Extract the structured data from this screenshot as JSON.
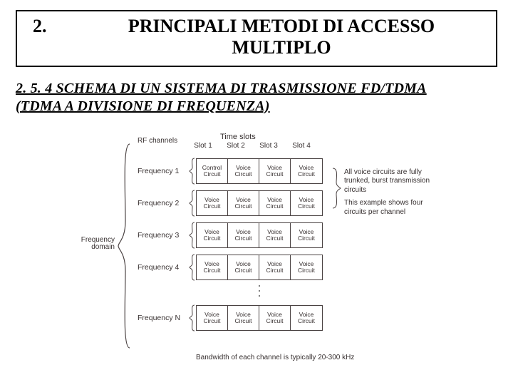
{
  "header": {
    "number": "2.",
    "title_line1": "PRINCIPALI METODI DI ACCESSO",
    "title_line2": "MULTIPLO"
  },
  "subtitle": {
    "line1": "2. 5. 4  SCHEMA DI UN SISTEMA DI TRASMISSIONE FD/TDMA",
    "line2": "(TDMA A DIVISIONE DI FREQUENZA)"
  },
  "diagram": {
    "time_label": "Time slots",
    "slot_headers": [
      "Slot 1",
      "Slot 2",
      "Slot 3",
      "Slot 4"
    ],
    "rf_label": "RF channels",
    "freq_domain_l1": "Frequency",
    "freq_domain_l2": "domain",
    "rows": [
      {
        "label": "Frequency 1",
        "cells": [
          [
            "Control",
            "Circuit"
          ],
          [
            "Voice",
            "Circuit"
          ],
          [
            "Voice",
            "Circuit"
          ],
          [
            "Voice",
            "Circuit"
          ]
        ]
      },
      {
        "label": "Frequency 2",
        "cells": [
          [
            "Voice",
            "Circuit"
          ],
          [
            "Voice",
            "Circuit"
          ],
          [
            "Voice",
            "Circuit"
          ],
          [
            "Voice",
            "Circuit"
          ]
        ]
      },
      {
        "label": "Frequency 3",
        "cells": [
          [
            "Voice",
            "Circuit"
          ],
          [
            "Voice",
            "Circuit"
          ],
          [
            "Voice",
            "Circuit"
          ],
          [
            "Voice",
            "Circuit"
          ]
        ]
      },
      {
        "label": "Frequency 4",
        "cells": [
          [
            "Voice",
            "Circuit"
          ],
          [
            "Voice",
            "Circuit"
          ],
          [
            "Voice",
            "Circuit"
          ],
          [
            "Voice",
            "Circuit"
          ]
        ]
      },
      {
        "label": "Frequency N",
        "cells": [
          [
            "Voice",
            "Circuit"
          ],
          [
            "Voice",
            "Circuit"
          ],
          [
            "Voice",
            "Circuit"
          ],
          [
            "Voice",
            "Circuit"
          ]
        ]
      }
    ],
    "note_p1": "All voice circuits are fully trunked, burst transmission circuits",
    "note_p2": "This example shows four circuits per channel",
    "footer": "Bandwidth of each channel is typically 20-300 kHz"
  }
}
